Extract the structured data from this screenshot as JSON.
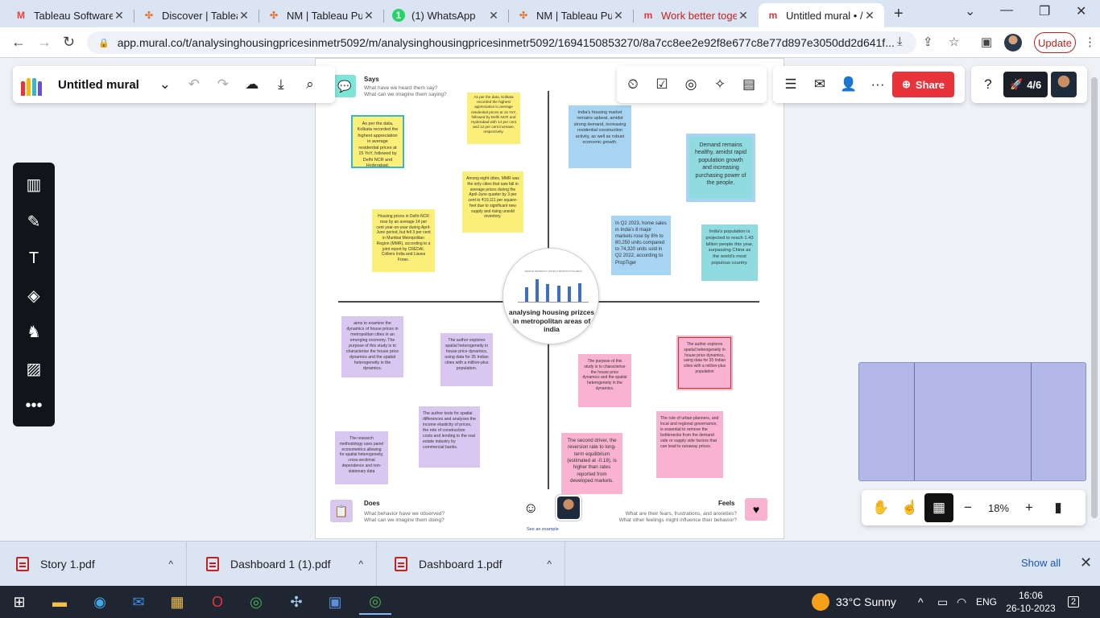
{
  "browser": {
    "tabs": [
      {
        "title": "Tableau Software",
        "icon": "gmail-icon",
        "color": "#ea4335"
      },
      {
        "title": "Discover | Tableau",
        "icon": "tableau-icon",
        "color": "#e8712b"
      },
      {
        "title": "NM | Tableau Pub",
        "icon": "tableau-icon",
        "color": "#e8712b"
      },
      {
        "title": "(1) WhatsApp",
        "icon": "whatsapp-icon",
        "color": "#25d366"
      },
      {
        "title": "NM | Tableau Pub",
        "icon": "tableau-icon",
        "color": "#e8712b"
      },
      {
        "title": "Work better toge",
        "icon": "mural-icon",
        "color": "#e8333b"
      },
      {
        "title": "Untitled mural • /",
        "icon": "mural-icon",
        "color": "#e8333b"
      }
    ],
    "url": "app.mural.co/t/analysinghousingpricesinmetr5092/m/analysinghousingpricesinmetr5092/1694150853270/8a7cc8ee2e92f8e677c8e77d897e3050dd2d641f...",
    "update_label": "Update"
  },
  "mural": {
    "title": "Untitled mural",
    "share_label": "Share",
    "timer_label": "4/6",
    "center_title": "analysing housing prizces in metropolitan areas of india",
    "center_chart_title": "AVERAGE RESIDENTIAL PRICES IN METROPOLITAN AREAS",
    "quadrants": {
      "says": {
        "title": "Says",
        "sub1": "What have we heard them say?",
        "sub2": "What can we imagine them saying?"
      },
      "does": {
        "title": "Does",
        "sub1": "What behavior have we observed?",
        "sub2": "What can we imagine them doing?"
      },
      "feels": {
        "title": "Feels",
        "sub1": "What are their fears, frustrations, and anxieties?",
        "sub2": "What other feelings might influence their behavior?"
      }
    },
    "see_example": "See an example",
    "zoom": "18%",
    "stickies": {
      "y1": "As per the data, Kolkata recorded the highest appreciation in average residential prices at 15 YoY, followed by Delhi NCR and Hyderabad.",
      "y2": "As per the data, Kolkata recorded the highest appreciation in average residential prices at 15 YoY, followed by Delhi NCR and Hyderabad with 14 per cent and 12 per cent increase, respectively.",
      "y3": "Among eight cities, MMR was the only cities that saw fall in average prices during the April-June quarter by 3 per cent to ₹19,111 per square-feet due to significant new supply and rising unsold inventory.",
      "y4": "Housing prices in Delhi-NCR rose by an average 14 per cent year-on-year during April-June period, but fell 3 per cent in Mumbai Metropolitan Region (MMR), according to a joint report by CREDAI, Colliers India and Liases Foras.",
      "b1": "India's housing market remains upbeat, amidst strong demand, increasing residential construction activity, as well as robust economic growth.",
      "b2": "In Q2 2023, home sales in India's 8 major markets rose by 8% to 80,250 units compared to 74,320 units sold in Q2 2022, according to PropTiger",
      "t1": "Demand remains healthy, amidst rapid population growth and increasing purchasing power of the people.",
      "t2": "India's population is projected to reach 1.43 billion people this year, surpassing China as the world's most populous country.",
      "p1": "aims to examine the dynamics of house prices in metropolitan cities in an emerging economy. The purpose of this study is to characterise the house price dynamics and the spatial heterogeneity in the dynamics.",
      "p2": "The author explores spatial heterogeneity in house price dynamics, using data for 35 Indian cities with a million-plus population.",
      "p3": "The author tests for spatial differences and analyses the income elasticity of prices, the role of construction costs and lending to the real estate industry by commercial banks.",
      "p4": "The research methodology uses panel econometrics allowing for spatial heterogeneity, cross-sectional dependence and non-stationary data",
      "k1": "The purpose of this study is to characterise the house price dynamics and the spatial heterogeneity in the dynamics.",
      "k2": "The author explores spatial heterogeneity in house price dynamics, using data for 35 Indian cities with a million-plus population",
      "k3": "The role of urban planners, and local and regional governance, is essential to remove the bottlenecks from the demand side or supply side factors that can lead to runaway prices.",
      "k4": "The second driver, the reversion rate to long-term equilibrium (estimated at -0.18), is higher than rates reported from developed markets."
    }
  },
  "downloads": {
    "items": [
      "Story 1.pdf",
      "Dashboard 1 (1).pdf",
      "Dashboard 1.pdf"
    ],
    "show_all": "Show all"
  },
  "taskbar": {
    "weather": "33°C  Sunny",
    "lang": "ENG",
    "time": "16:06",
    "date": "26-10-2023",
    "notifications": "2"
  }
}
